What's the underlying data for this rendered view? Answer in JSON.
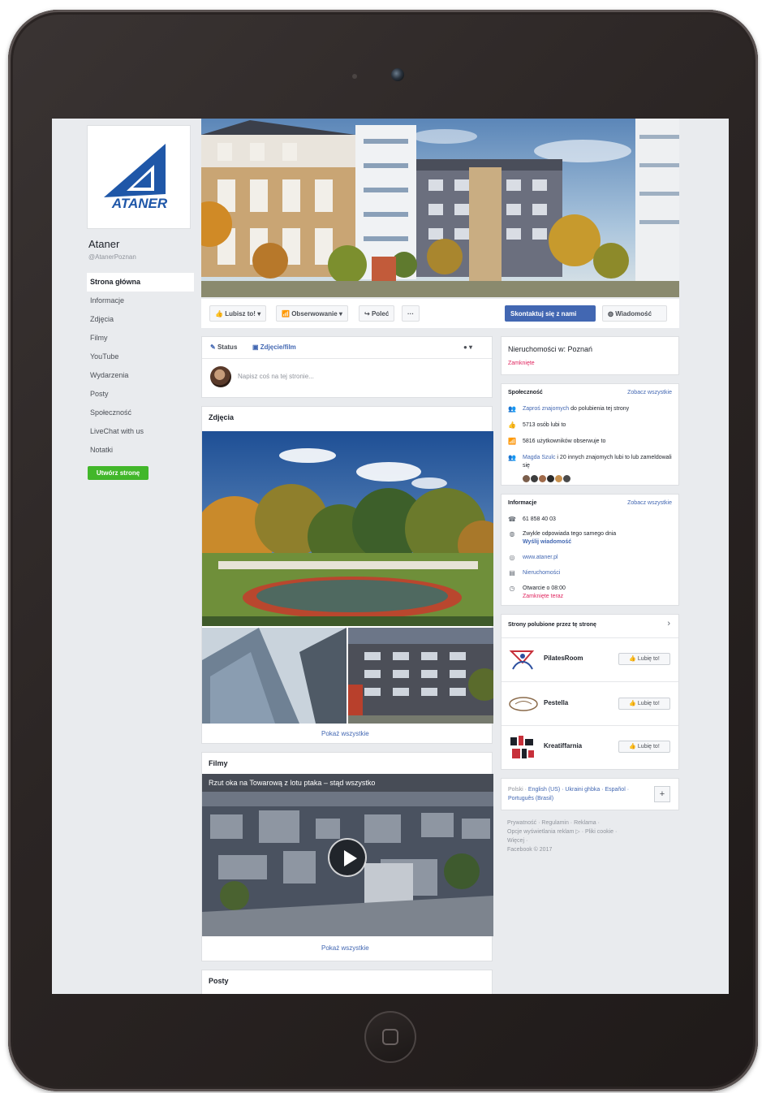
{
  "page": {
    "name": "Ataner",
    "handle": "@AtanerPoznan",
    "logo_text": "ATANER"
  },
  "nav": {
    "items": [
      "Strona główna",
      "Informacje",
      "Zdjęcia",
      "Filmy",
      "YouTube",
      "Wydarzenia",
      "Posty",
      "Społeczność",
      "LiveChat with us",
      "Notatki"
    ],
    "active_index": 0,
    "create_page": "Utwórz stronę"
  },
  "actions": {
    "like": "Lubisz to!",
    "follow": "Obserwowanie",
    "share": "Poleć",
    "more": "···",
    "contact": "Skontaktuj się z nami",
    "message": "Wiadomość"
  },
  "composer": {
    "status_tab": "Status",
    "photo_tab": "Zdjęcie/film",
    "placeholder": "Napisz coś na tej stronie..."
  },
  "photos": {
    "title": "Zdjęcia",
    "see_all": "Pokaż wszystkie"
  },
  "videos": {
    "title": "Filmy",
    "caption": "Rzut oka na Towarową z lotu ptaka – stąd wszystko",
    "see_all": "Pokaż wszystkie"
  },
  "posts": {
    "title": "Posty"
  },
  "category": {
    "title": "Nieruchomości w: Poznań",
    "status": "Zamknięte"
  },
  "community": {
    "title": "Społeczność",
    "see_all": "Zobacz wszystkie",
    "invite_link": "Zaproś znajomych",
    "invite_rest": "do polubienia tej strony",
    "likes": "5713 osób lubi to",
    "followers": "5816 użytkowników obserwuje to",
    "friend_name": "Magda Szulc",
    "friends_rest": "i 20 innych znajomych lubi to lub zameldowali się"
  },
  "info": {
    "title": "Informacje",
    "see_all": "Zobacz wszystkie",
    "phone": "61 858 40 03",
    "response": "Zwykle odpowiada tego samego dnia",
    "send_message": "Wyślij wiadomość",
    "website": "www.ataner.pl",
    "category": "Nieruchomości",
    "hours": "Otwarcie o 08:00",
    "closed_now": "Zamknięte teraz"
  },
  "liked_pages": {
    "title": "Strony polubione przez tę stronę",
    "like_label": "Lubię to!",
    "items": [
      "PilatesRoom",
      "Pestella",
      "Kreatiffarnia"
    ]
  },
  "languages": {
    "current": "Polski",
    "links": "English (US) · Ukraini ghbka · Español · Português (Brasil)",
    "add": "+"
  },
  "footer": {
    "line1": "Prywatność · Regulamin · Reklama ·",
    "line2": "Opcje wyświetlania reklam ▷ · Pliki cookie ·",
    "line3": "Więcej ·",
    "line4": "Facebook © 2017"
  }
}
